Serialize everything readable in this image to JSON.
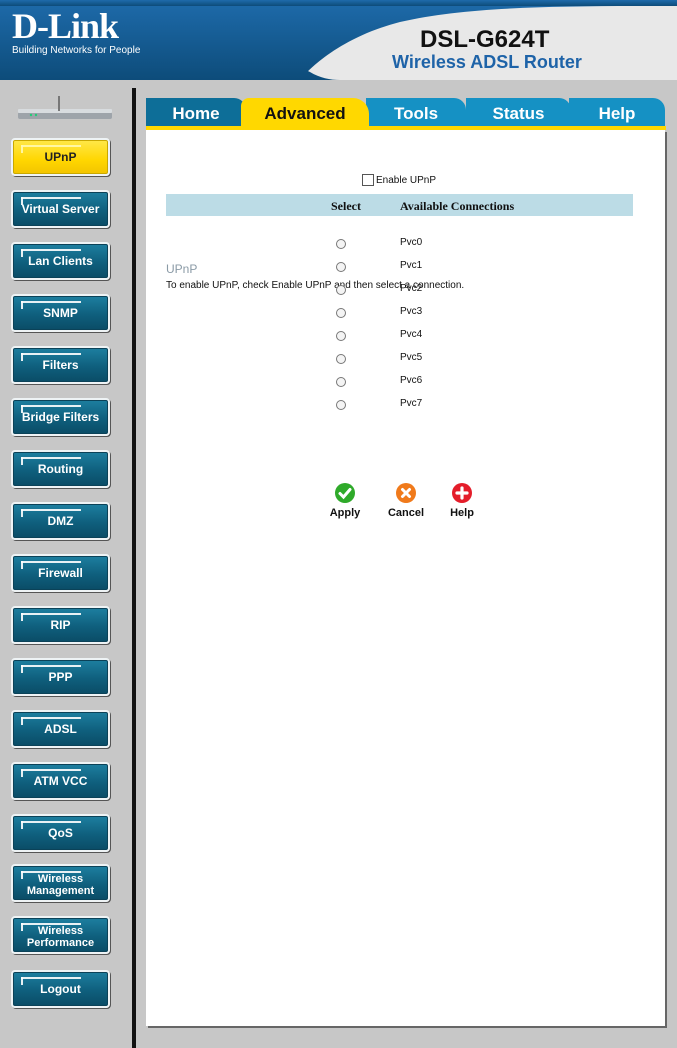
{
  "header": {
    "brand": "D-Link",
    "tagline": "Building Networks for People",
    "model": "DSL-G624T",
    "product": "Wireless ADSL Router"
  },
  "sidebar": {
    "items": [
      {
        "label": "UPnP",
        "active": true
      },
      {
        "label": "Virtual Server"
      },
      {
        "label": "Lan Clients"
      },
      {
        "label": "SNMP"
      },
      {
        "label": "Filters"
      },
      {
        "label": "Bridge Filters"
      },
      {
        "label": "Routing"
      },
      {
        "label": "DMZ"
      },
      {
        "label": "Firewall"
      },
      {
        "label": "RIP"
      },
      {
        "label": "PPP"
      },
      {
        "label": "ADSL"
      },
      {
        "label": "ATM VCC"
      },
      {
        "label": "QoS"
      },
      {
        "label": "Wireless Management"
      },
      {
        "label": "Wireless Performance"
      },
      {
        "label": "Logout"
      }
    ]
  },
  "tabs": [
    {
      "label": "Home"
    },
    {
      "label": "Advanced",
      "active": true
    },
    {
      "label": "Tools"
    },
    {
      "label": "Status"
    },
    {
      "label": "Help"
    }
  ],
  "main": {
    "title": "UPnP",
    "description": "To enable UPnP, check Enable UPnP and then select a connection.",
    "enable_label": "Enable UPnP",
    "enable_checked": false,
    "table_headers": {
      "select": "Select",
      "connections": "Available Connections"
    },
    "connections": [
      "Pvc0",
      "Pvc1",
      "Pvc2",
      "Pvc3",
      "Pvc4",
      "Pvc5",
      "Pvc6",
      "Pvc7"
    ],
    "buttons": {
      "apply": "Apply",
      "cancel": "Cancel",
      "help": "Help"
    }
  },
  "colors": {
    "header_blue": "#165f95",
    "active_yellow": "#ffd800",
    "tab_blue": "#1591c4",
    "nav_teal": "#0f5f7d",
    "table_header": "#bcdce6"
  }
}
